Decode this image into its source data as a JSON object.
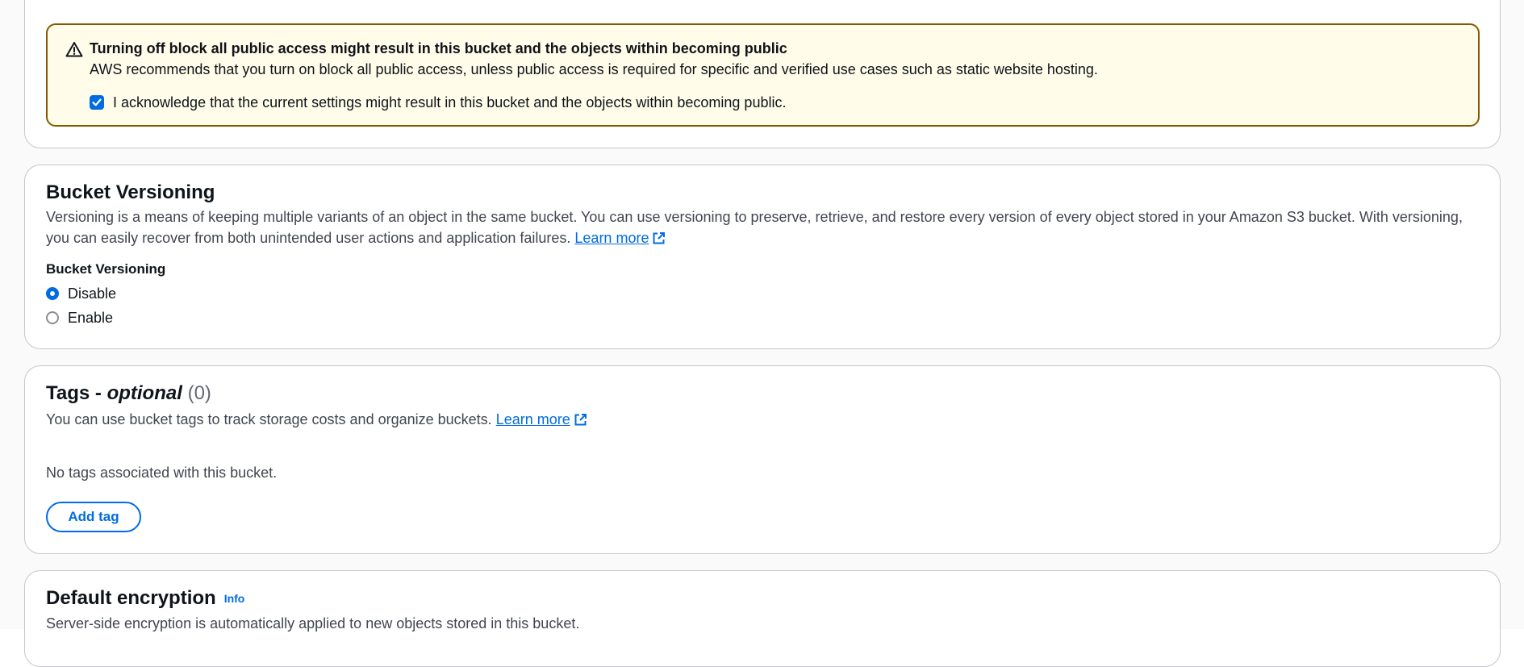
{
  "warning": {
    "title": "Turning off block all public access might result in this bucket and the objects within becoming public",
    "text": "AWS recommends that you turn on block all public access, unless public access is required for specific and verified use cases such as static website hosting.",
    "acknowledge_label": "I acknowledge that the current settings might result in this bucket and the objects within becoming public.",
    "acknowledge_checked": true
  },
  "versioning": {
    "heading": "Bucket Versioning",
    "description": "Versioning is a means of keeping multiple variants of an object in the same bucket. You can use versioning to preserve, retrieve, and restore every version of every object stored in your Amazon S3 bucket. With versioning, you can easily recover from both unintended user actions and application failures.",
    "learn_more": "Learn more",
    "field_label": "Bucket Versioning",
    "options": [
      "Disable",
      "Enable"
    ],
    "selected": "Disable"
  },
  "tags": {
    "heading_main": "Tags -",
    "heading_optional": "optional",
    "count": "(0)",
    "description": "You can use bucket tags to track storage costs and organize buckets.",
    "learn_more": "Learn more",
    "empty_text": "No tags associated with this bucket.",
    "add_button": "Add tag"
  },
  "encryption": {
    "heading": "Default encryption",
    "info": "Info",
    "description": "Server-side encryption is automatically applied to new objects stored in this bucket."
  },
  "colors": {
    "accent": "#006ce0",
    "warning_border": "#855900",
    "warning_bg": "#fffce9"
  }
}
